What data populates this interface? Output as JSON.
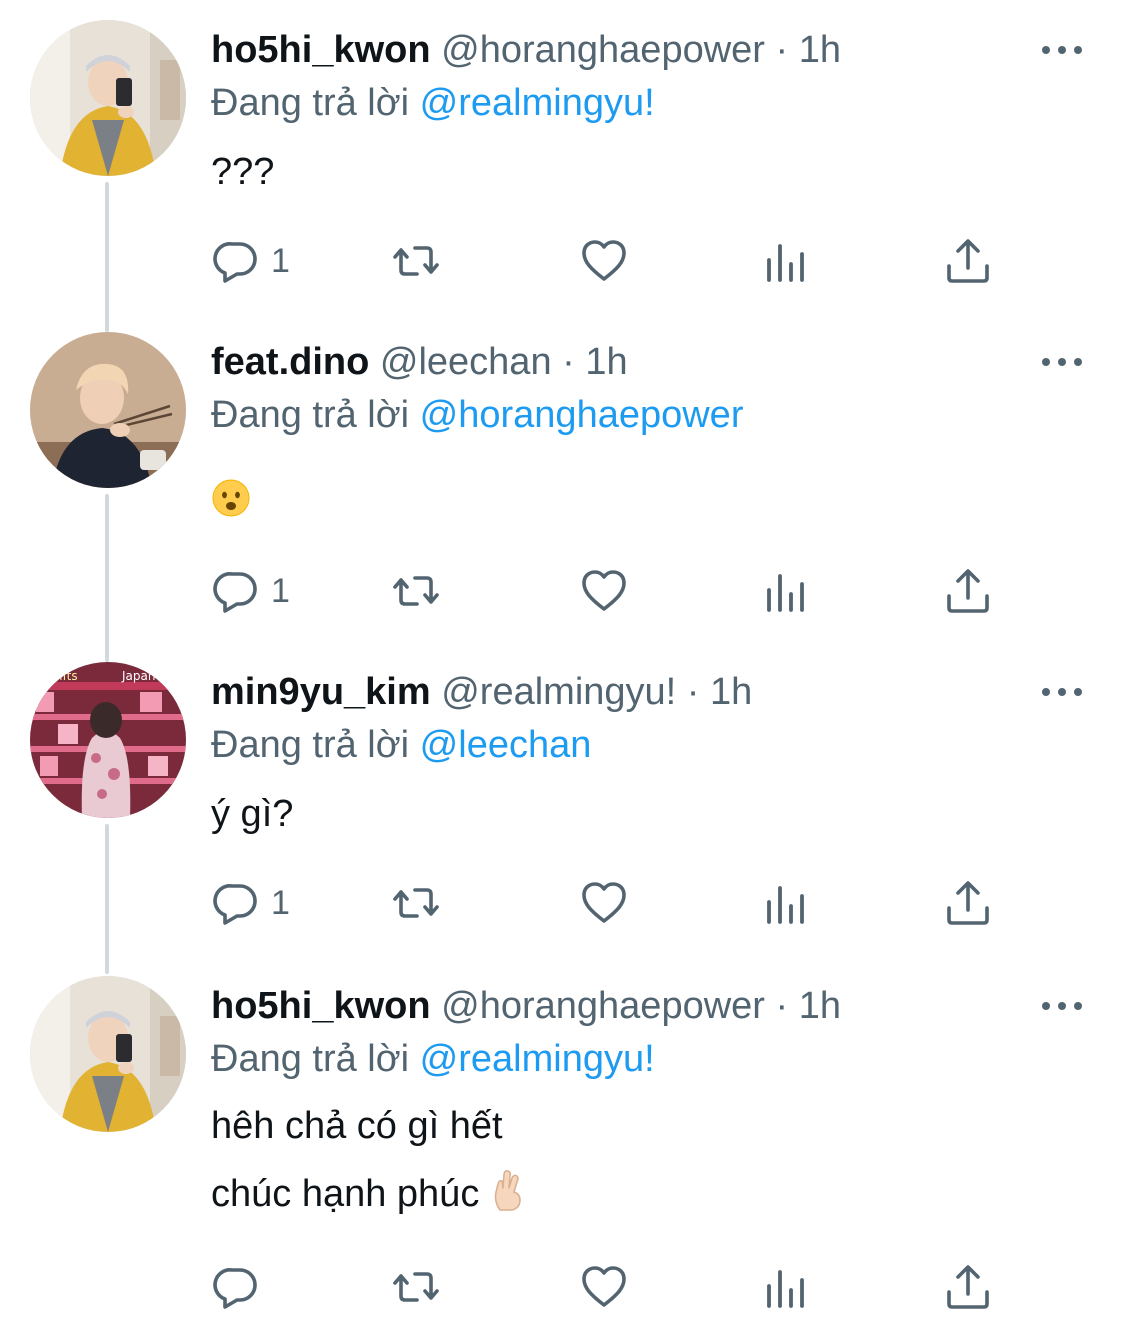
{
  "colors": {
    "accent": "#1d9bf0",
    "secondary_text": "#536471",
    "thread_line": "#cfd9de"
  },
  "tweets": [
    {
      "name": "ho5hi_kwon",
      "handle": "@horanghaepower",
      "dot": "·",
      "time": "1h",
      "replying_prefix": "Đang trả lời",
      "replying_to": "@realmingyu!",
      "body": [
        "???"
      ],
      "reply_count": "1",
      "avatar": "avatar-photo-yellow-jacket"
    },
    {
      "name": "feat.dino",
      "handle": "@leechan",
      "dot": "·",
      "time": "1h",
      "replying_prefix": "Đang trả lời",
      "replying_to": "@horanghaepower",
      "body_emoji": "frowning-face-emoji",
      "reply_count": "1",
      "avatar": "avatar-photo-blond"
    },
    {
      "name": "min9yu_kim",
      "handle": "@realmingyu!",
      "dot": "·",
      "time": "1h",
      "replying_prefix": "Đang trả lời",
      "replying_to": "@leechan",
      "body": [
        "ý gì?"
      ],
      "reply_count": "1",
      "avatar": "avatar-photo-gift-shop"
    },
    {
      "name": "ho5hi_kwon",
      "handle": "@horanghaepower",
      "dot": "·",
      "time": "1h",
      "replying_prefix": "Đang trả lời",
      "replying_to": "@realmingyu!",
      "body": [
        "hêh chả có gì hết",
        "chúc hạnh phúc"
      ],
      "body_emoji": "crossed-fingers-emoji",
      "reply_count": "",
      "avatar": "avatar-photo-yellow-jacket"
    }
  ],
  "icons": {
    "reply": "reply-icon",
    "retweet": "retweet-icon",
    "like": "like-icon",
    "views": "views-icon",
    "share": "share-icon",
    "more": "more-icon"
  }
}
